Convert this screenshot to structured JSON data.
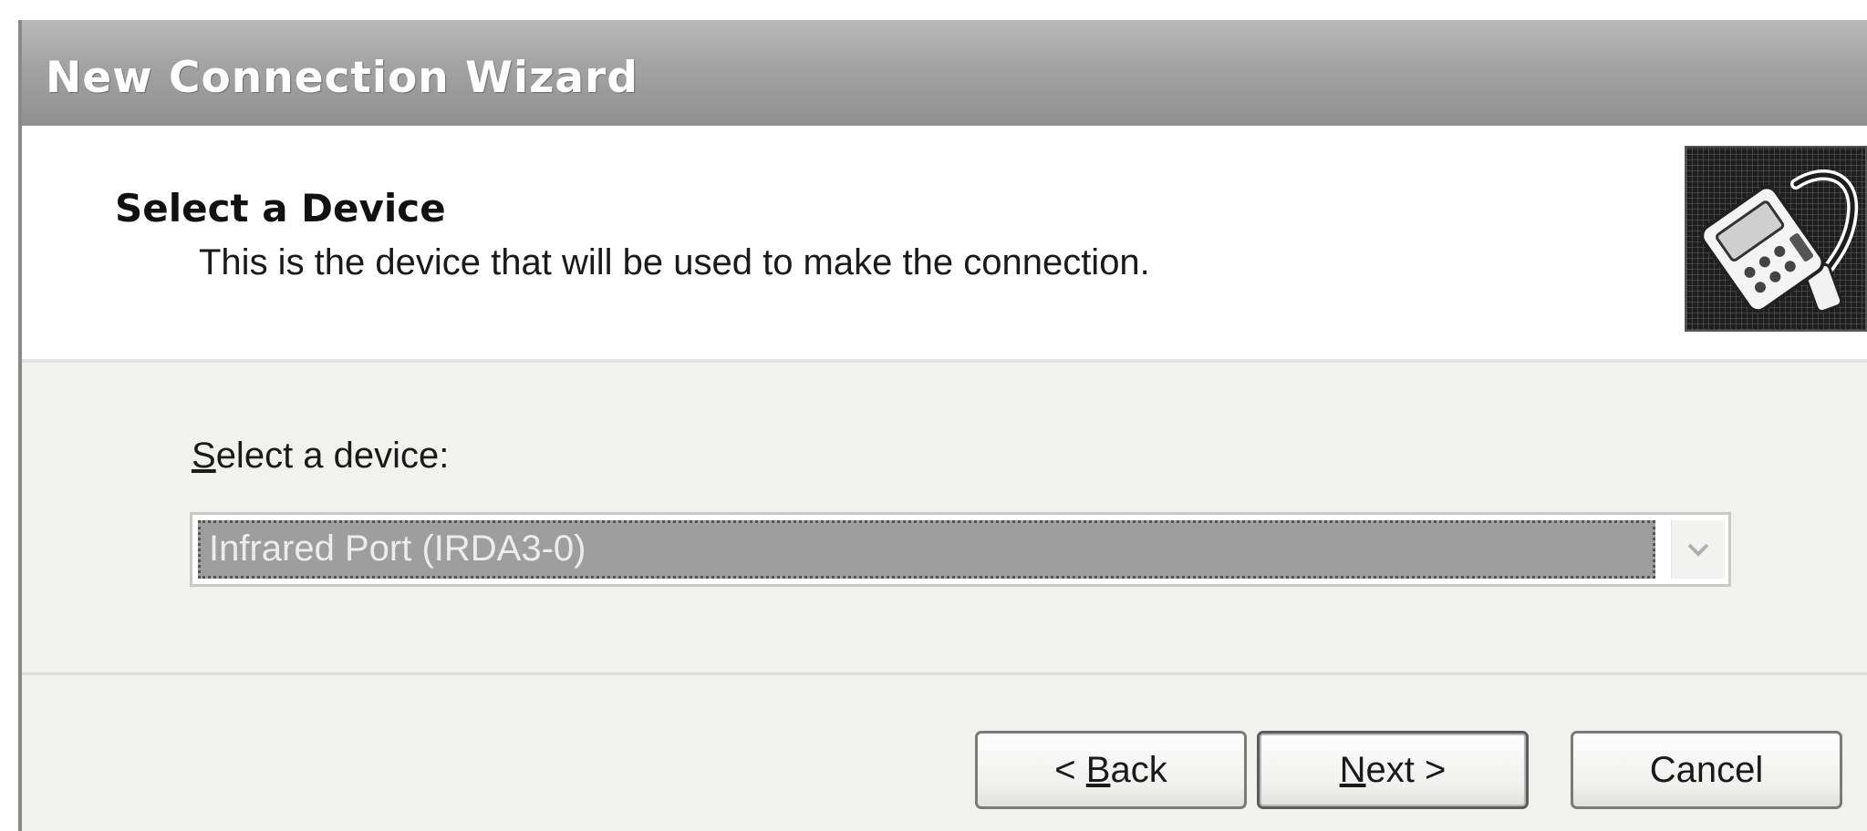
{
  "window": {
    "title": "New Connection Wizard"
  },
  "header": {
    "title": "Select a Device",
    "subtitle": "This is the device that will be used to make the connection.",
    "icon": "wizard-device-icon"
  },
  "device_field": {
    "label_mnemonic": "S",
    "label_rest": "elect a device:",
    "selected_value": "Infrared Port (IRDA3-0)",
    "dropdown_icon": "chevron-down-icon"
  },
  "buttons": {
    "back_prefix": "< ",
    "back_mnemonic": "B",
    "back_rest": "ack",
    "next_mnemonic": "N",
    "next_rest": "ext >",
    "cancel_label": "Cancel"
  }
}
